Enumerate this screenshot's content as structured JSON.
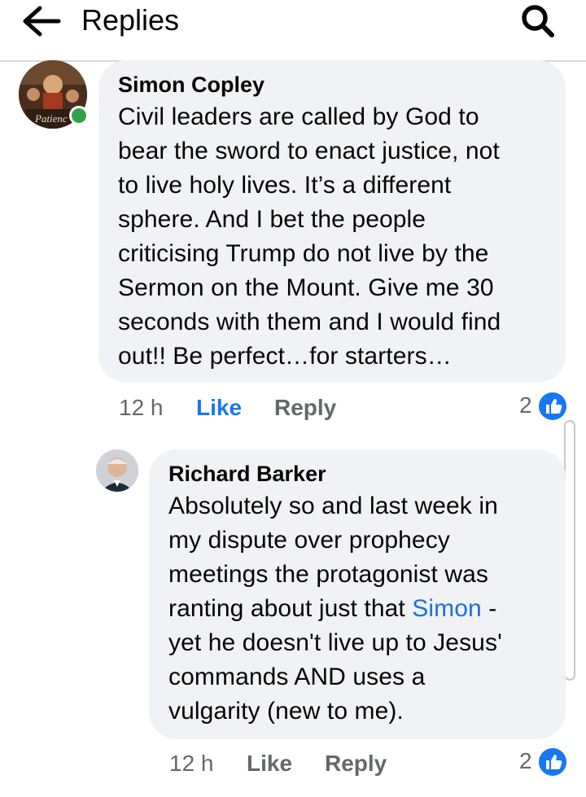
{
  "header": {
    "title": "Replies",
    "back_icon": "arrow-left-icon",
    "search_icon": "search-icon"
  },
  "comments": [
    {
      "author": "Simon Copley",
      "avatar_caption": "Patienc",
      "online": true,
      "text_lines": [
        "Civil leaders are called by God to",
        "bear the sword to enact justice, not",
        "to live holy lives. It’s a different",
        "sphere. And I bet the people",
        "criticising Trump do not live by the",
        "Sermon on the Mount. Give me 30",
        "seconds with them and I would find",
        "out!! Be perfect…for starters…"
      ],
      "time": "12 h",
      "like_label": "Like",
      "like_active": true,
      "reply_label": "Reply",
      "reaction_count": "2"
    },
    {
      "author": "Richard Barker",
      "text_lines": [
        "Absolutely so and last week in",
        "my dispute over prophecy",
        "meetings the protagonist was",
        "ranting about just that ",
        "yet he doesn't live up to Jesus'",
        "commands AND uses a",
        "vulgarity (new to me)."
      ],
      "mention": "Simon",
      "mention_suffix": " -",
      "time": "12 h",
      "like_label": "Like",
      "like_active": false,
      "reply_label": "Reply",
      "reaction_count": "2"
    }
  ],
  "colors": {
    "accent": "#1877f2",
    "mention": "#216fdb",
    "bubble": "#f0f2f5",
    "muted": "#65676b",
    "online": "#31a24c"
  }
}
